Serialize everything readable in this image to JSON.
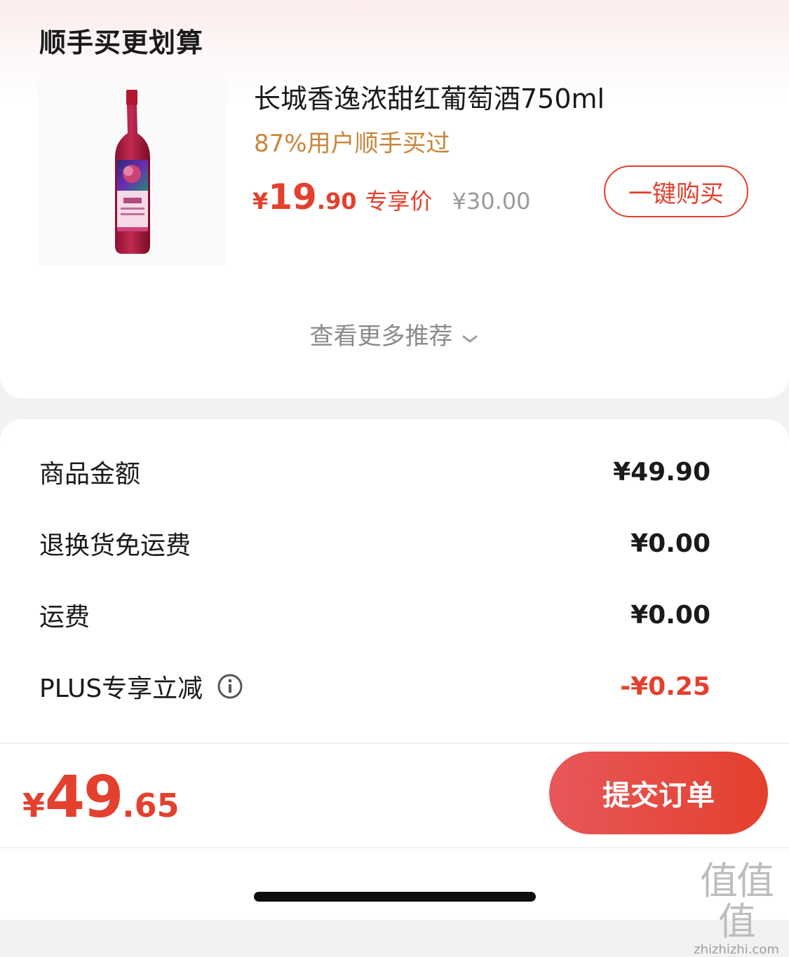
{
  "recommend": {
    "title": "顺手买更划算",
    "product": {
      "name": "长城香逸浓甜红葡萄酒750ml",
      "tag": "87%用户顺手买过",
      "price_symbol": "¥",
      "price_int": "19",
      "price_dec": ".90",
      "price_label": "专享价",
      "original_price": "¥30.00",
      "image_icon": "wine-bottle-icon"
    },
    "buy_button": "一键购买",
    "more_link": "查看更多推荐"
  },
  "summary": {
    "rows": [
      {
        "label": "商品金额",
        "value": "¥49.90"
      },
      {
        "label": "退换货免运费",
        "value": "¥0.00"
      },
      {
        "label": "运费",
        "value": "¥0.00"
      },
      {
        "label": "PLUS专享立减",
        "value": "-¥0.25"
      }
    ]
  },
  "footer": {
    "total_symbol": "¥",
    "total_int": "49",
    "total_dec": ".65",
    "submit_button": "提交订单"
  },
  "watermark": {
    "big": "值值值",
    "small": "zhizhizhi.com"
  },
  "colors": {
    "accent": "#e3402d",
    "tag": "#c8863a"
  }
}
